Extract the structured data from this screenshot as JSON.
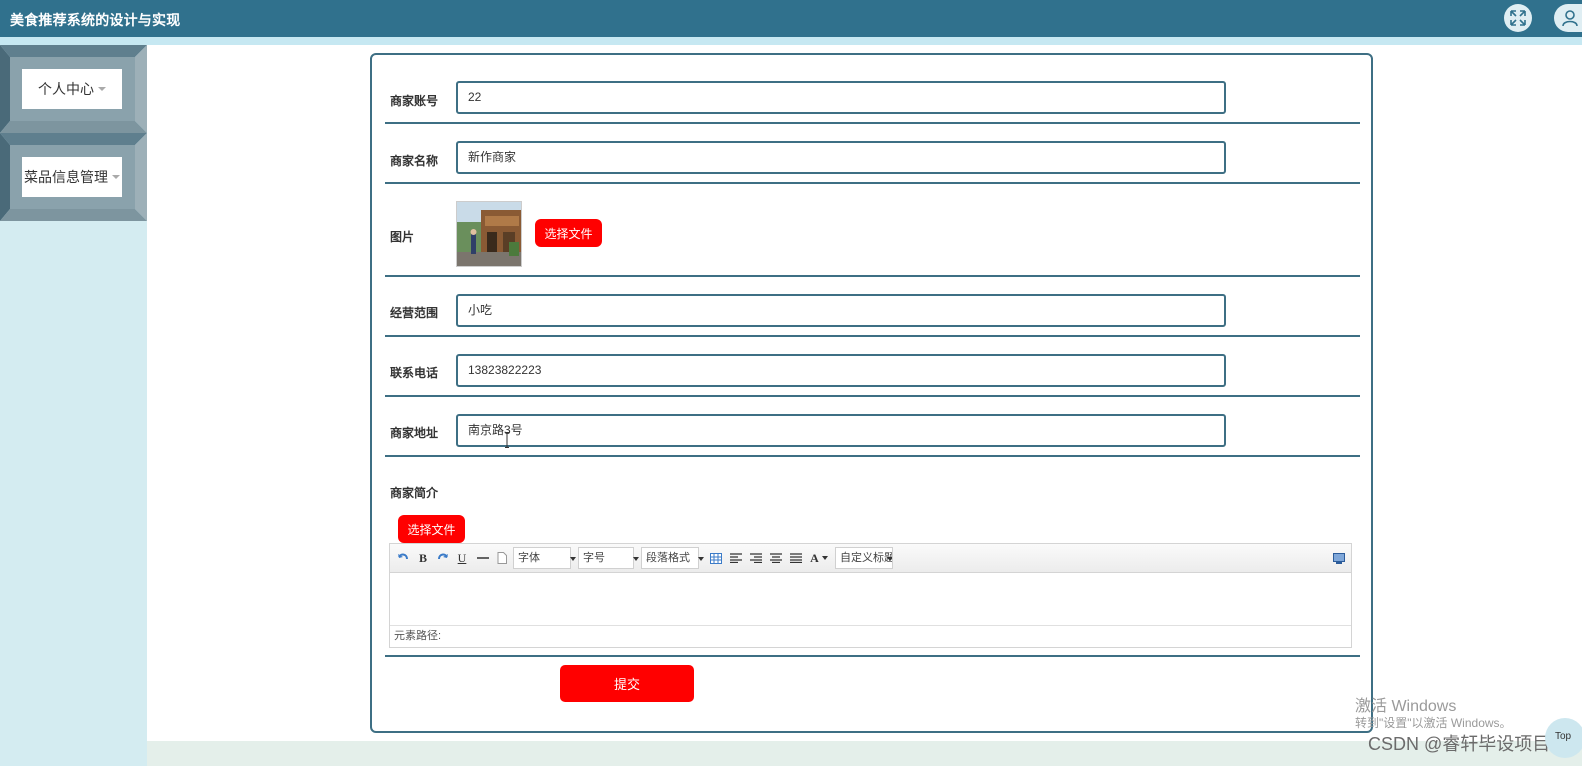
{
  "app": {
    "title": "美食推荐系统的设计与实现"
  },
  "header_icons": [
    "expand-icon",
    "user-icon"
  ],
  "sidebar": {
    "items": [
      {
        "label": "个人中心"
      },
      {
        "label": "菜品信息管理"
      }
    ]
  },
  "form": {
    "fields": [
      {
        "label": "商家账号",
        "value": "22"
      },
      {
        "label": "商家名称",
        "value": "新作商家"
      },
      {
        "label": "图片"
      },
      {
        "label": "经营范围",
        "value": "小吃"
      },
      {
        "label": "联系电话",
        "value": "13823822223"
      },
      {
        "label": "商家地址",
        "value": "南京路3号"
      },
      {
        "label": "商家简介"
      }
    ],
    "choose_file_label": "选择文件",
    "editor_choose_file_label": "选择文件",
    "submit_label": "提交"
  },
  "editor": {
    "toolbar": {
      "font": "字体",
      "size": "字号",
      "paragraph": "段落格式",
      "custom_title": "自定义标题",
      "bold": "B",
      "underline": "U",
      "font_color": "A"
    },
    "status_text": "元素路径:"
  },
  "overlay": {
    "activate_title": "激活 Windows",
    "activate_sub": "转到\"设置\"以激活 Windows。",
    "csdn": "CSDN @睿轩毕设项目",
    "top_btn": "Top"
  },
  "colors": {
    "header": "#30718d",
    "accent_red": "#ff0000",
    "border": "#3e6f84",
    "sidebar_bg": "#d4ecf1"
  }
}
